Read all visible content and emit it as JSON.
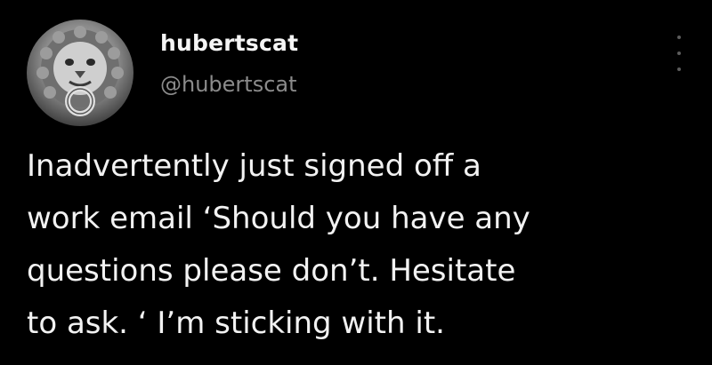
{
  "tweet": {
    "display_name": "hubertscat",
    "handle": "@hubertscat",
    "avatar_icon": "lion-door-knocker-avatar",
    "more_icon": "more-options-icon",
    "text_lines": [
      "Inadvertently just signed off a",
      "work email ‘Should you have any",
      "questions please don’t. Hesitate",
      "to ask. ‘ I’m sticking with it."
    ]
  },
  "colors": {
    "background": "#000000",
    "text": "#f2f2f2",
    "handle": "#8b8b8b"
  }
}
